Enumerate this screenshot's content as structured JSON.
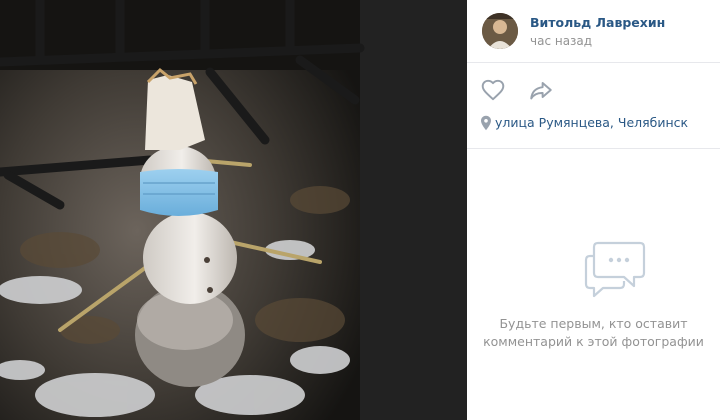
{
  "author": {
    "name": "Витольд Лаврехин",
    "time": "час назад"
  },
  "actions": {
    "like_icon": "heart-icon",
    "share_icon": "share-arrow-icon"
  },
  "location": {
    "icon": "map-pin-icon",
    "text": "улица Румянцева, Челябинск"
  },
  "comments": {
    "icon": "chat-bubble-icon",
    "empty_line1": "Будьте первым, кто оставит",
    "empty_line2": "комментарий к этой фотографии"
  },
  "colors": {
    "link": "#2a5885",
    "muted": "#939393",
    "icon_gray": "#99a2ad",
    "divider": "#e7e8ec",
    "backdrop": "#1f1f1f"
  }
}
